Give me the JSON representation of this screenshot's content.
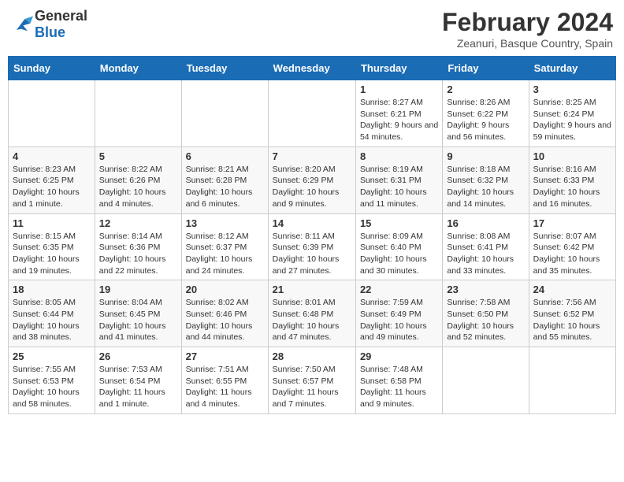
{
  "logo": {
    "text_general": "General",
    "text_blue": "Blue"
  },
  "title": "February 2024",
  "subtitle": "Zeanuri, Basque Country, Spain",
  "days_of_week": [
    "Sunday",
    "Monday",
    "Tuesday",
    "Wednesday",
    "Thursday",
    "Friday",
    "Saturday"
  ],
  "weeks": [
    [
      {
        "day": "",
        "info": ""
      },
      {
        "day": "",
        "info": ""
      },
      {
        "day": "",
        "info": ""
      },
      {
        "day": "",
        "info": ""
      },
      {
        "day": "1",
        "info": "Sunrise: 8:27 AM\nSunset: 6:21 PM\nDaylight: 9 hours and 54 minutes."
      },
      {
        "day": "2",
        "info": "Sunrise: 8:26 AM\nSunset: 6:22 PM\nDaylight: 9 hours and 56 minutes."
      },
      {
        "day": "3",
        "info": "Sunrise: 8:25 AM\nSunset: 6:24 PM\nDaylight: 9 hours and 59 minutes."
      }
    ],
    [
      {
        "day": "4",
        "info": "Sunrise: 8:23 AM\nSunset: 6:25 PM\nDaylight: 10 hours and 1 minute."
      },
      {
        "day": "5",
        "info": "Sunrise: 8:22 AM\nSunset: 6:26 PM\nDaylight: 10 hours and 4 minutes."
      },
      {
        "day": "6",
        "info": "Sunrise: 8:21 AM\nSunset: 6:28 PM\nDaylight: 10 hours and 6 minutes."
      },
      {
        "day": "7",
        "info": "Sunrise: 8:20 AM\nSunset: 6:29 PM\nDaylight: 10 hours and 9 minutes."
      },
      {
        "day": "8",
        "info": "Sunrise: 8:19 AM\nSunset: 6:31 PM\nDaylight: 10 hours and 11 minutes."
      },
      {
        "day": "9",
        "info": "Sunrise: 8:18 AM\nSunset: 6:32 PM\nDaylight: 10 hours and 14 minutes."
      },
      {
        "day": "10",
        "info": "Sunrise: 8:16 AM\nSunset: 6:33 PM\nDaylight: 10 hours and 16 minutes."
      }
    ],
    [
      {
        "day": "11",
        "info": "Sunrise: 8:15 AM\nSunset: 6:35 PM\nDaylight: 10 hours and 19 minutes."
      },
      {
        "day": "12",
        "info": "Sunrise: 8:14 AM\nSunset: 6:36 PM\nDaylight: 10 hours and 22 minutes."
      },
      {
        "day": "13",
        "info": "Sunrise: 8:12 AM\nSunset: 6:37 PM\nDaylight: 10 hours and 24 minutes."
      },
      {
        "day": "14",
        "info": "Sunrise: 8:11 AM\nSunset: 6:39 PM\nDaylight: 10 hours and 27 minutes."
      },
      {
        "day": "15",
        "info": "Sunrise: 8:09 AM\nSunset: 6:40 PM\nDaylight: 10 hours and 30 minutes."
      },
      {
        "day": "16",
        "info": "Sunrise: 8:08 AM\nSunset: 6:41 PM\nDaylight: 10 hours and 33 minutes."
      },
      {
        "day": "17",
        "info": "Sunrise: 8:07 AM\nSunset: 6:42 PM\nDaylight: 10 hours and 35 minutes."
      }
    ],
    [
      {
        "day": "18",
        "info": "Sunrise: 8:05 AM\nSunset: 6:44 PM\nDaylight: 10 hours and 38 minutes."
      },
      {
        "day": "19",
        "info": "Sunrise: 8:04 AM\nSunset: 6:45 PM\nDaylight: 10 hours and 41 minutes."
      },
      {
        "day": "20",
        "info": "Sunrise: 8:02 AM\nSunset: 6:46 PM\nDaylight: 10 hours and 44 minutes."
      },
      {
        "day": "21",
        "info": "Sunrise: 8:01 AM\nSunset: 6:48 PM\nDaylight: 10 hours and 47 minutes."
      },
      {
        "day": "22",
        "info": "Sunrise: 7:59 AM\nSunset: 6:49 PM\nDaylight: 10 hours and 49 minutes."
      },
      {
        "day": "23",
        "info": "Sunrise: 7:58 AM\nSunset: 6:50 PM\nDaylight: 10 hours and 52 minutes."
      },
      {
        "day": "24",
        "info": "Sunrise: 7:56 AM\nSunset: 6:52 PM\nDaylight: 10 hours and 55 minutes."
      }
    ],
    [
      {
        "day": "25",
        "info": "Sunrise: 7:55 AM\nSunset: 6:53 PM\nDaylight: 10 hours and 58 minutes."
      },
      {
        "day": "26",
        "info": "Sunrise: 7:53 AM\nSunset: 6:54 PM\nDaylight: 11 hours and 1 minute."
      },
      {
        "day": "27",
        "info": "Sunrise: 7:51 AM\nSunset: 6:55 PM\nDaylight: 11 hours and 4 minutes."
      },
      {
        "day": "28",
        "info": "Sunrise: 7:50 AM\nSunset: 6:57 PM\nDaylight: 11 hours and 7 minutes."
      },
      {
        "day": "29",
        "info": "Sunrise: 7:48 AM\nSunset: 6:58 PM\nDaylight: 11 hours and 9 minutes."
      },
      {
        "day": "",
        "info": ""
      },
      {
        "day": "",
        "info": ""
      }
    ]
  ]
}
